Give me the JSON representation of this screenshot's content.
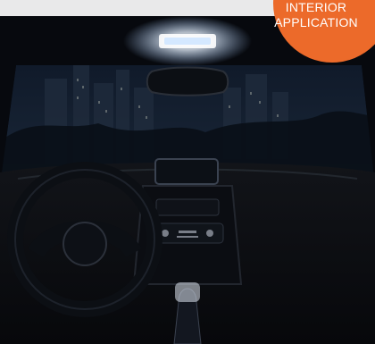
{
  "badge": {
    "line1": "INTERIOR",
    "line2": "APPLICATION",
    "color": "#ec6a2a"
  }
}
